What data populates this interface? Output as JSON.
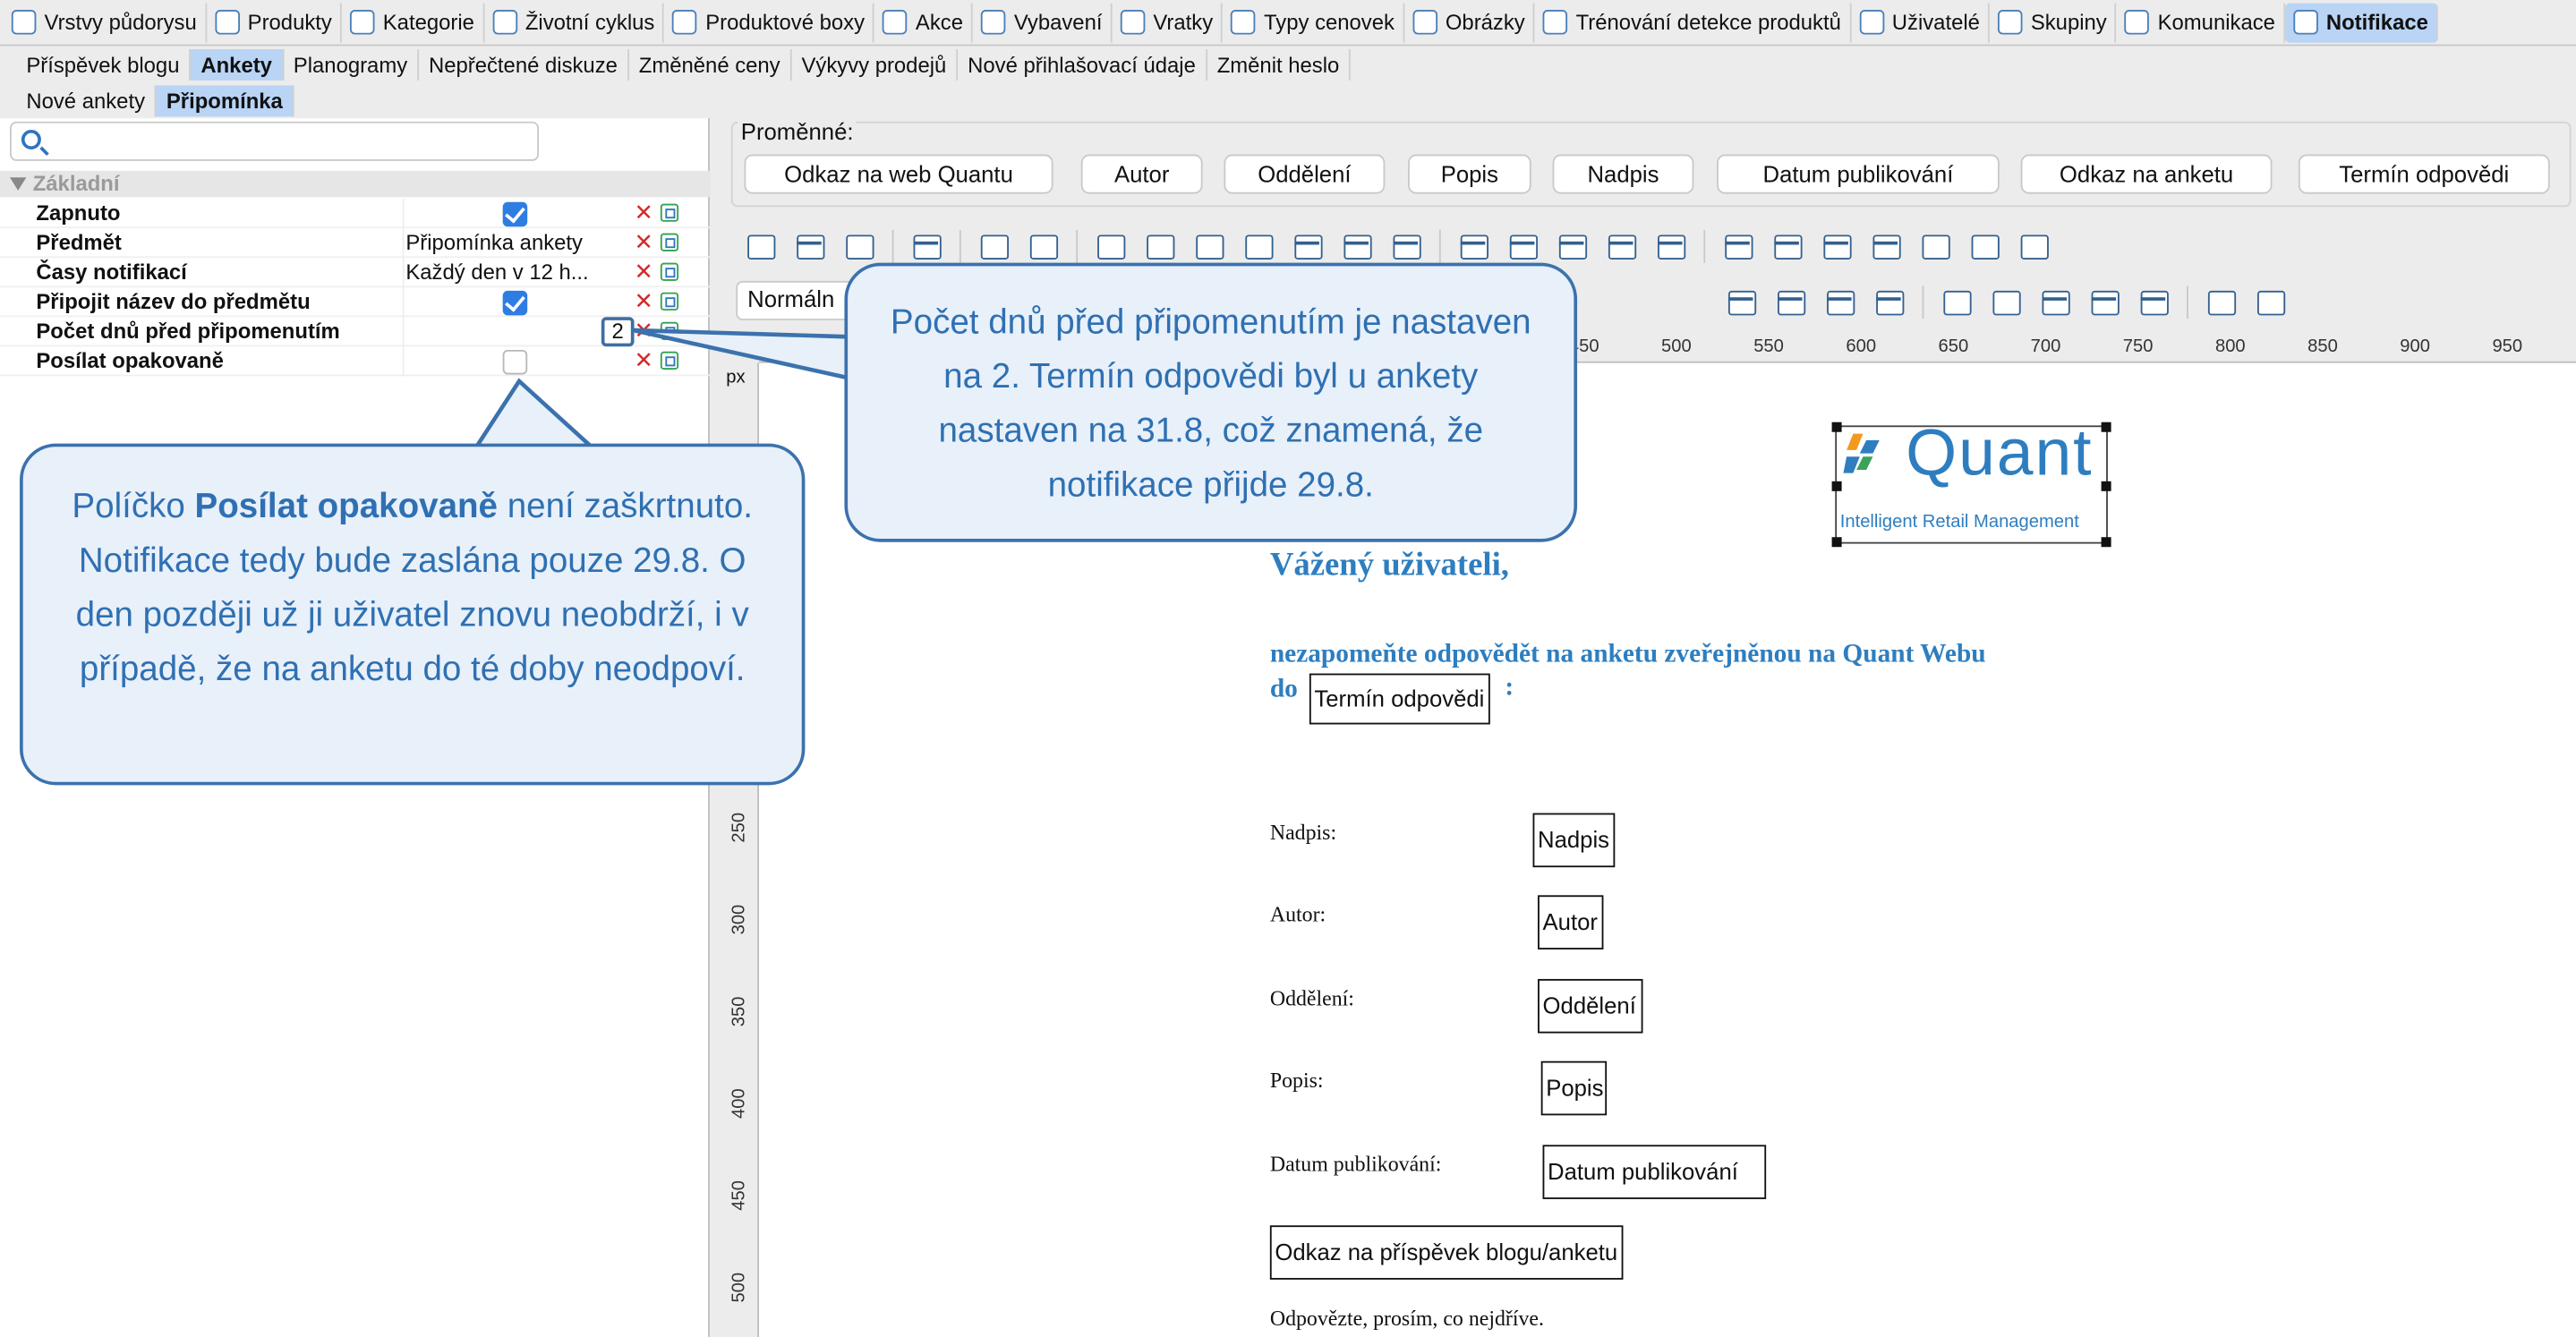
{
  "top_tabs": [
    {
      "label": "Vrstvy půdorysu",
      "icon": "floor-layers-icon"
    },
    {
      "label": "Produkty",
      "icon": "products-icon"
    },
    {
      "label": "Kategorie",
      "icon": "categories-icon"
    },
    {
      "label": "Životní cyklus",
      "icon": "lifecycle-icon"
    },
    {
      "label": "Produktové boxy",
      "icon": "product-boxes-icon"
    },
    {
      "label": "Akce",
      "icon": "promotions-icon"
    },
    {
      "label": "Vybavení",
      "icon": "equipment-icon"
    },
    {
      "label": "Vratky",
      "icon": "returns-icon"
    },
    {
      "label": "Typy cenovek",
      "icon": "price-tag-icon"
    },
    {
      "label": "Obrázky",
      "icon": "images-icon"
    },
    {
      "label": "Trénování detekce produktů",
      "icon": "training-icon"
    },
    {
      "label": "Uživatelé",
      "icon": "users-icon"
    },
    {
      "label": "Skupiny",
      "icon": "groups-icon"
    },
    {
      "label": "Komunikace",
      "icon": "mail-icon"
    },
    {
      "label": "Notifikace",
      "icon": "notification-icon"
    }
  ],
  "sub_tabs": [
    "Příspěvek blogu",
    "Ankety",
    "Planogramy",
    "Nepřečtené diskuze",
    "Změněné ceny",
    "Výkyvy prodejů",
    "Nové přihlašovací údaje",
    "Změnit heslo"
  ],
  "sub_tabs2": [
    "Nové ankety",
    "Připomínka"
  ],
  "group": "Základní",
  "props": [
    {
      "name": "Zapnuto",
      "value": "",
      "checked": true
    },
    {
      "name": "Předmět",
      "value": "Připomínka ankety"
    },
    {
      "name": "Časy notifikací",
      "value": "Každý den v 12 h..."
    },
    {
      "name": "Připojit název do předmětu",
      "value": "",
      "checked": true
    },
    {
      "name": "Počet dnů před připomenutím",
      "value": "2"
    },
    {
      "name": "Posílat opakovaně",
      "value": "",
      "checked": false
    }
  ],
  "variables_label": "Proměnné:",
  "variables": [
    "Odkaz na web Quantu",
    "Autor",
    "Oddělení",
    "Popis",
    "Nadpis",
    "Datum publikování",
    "Odkaz na anketu",
    "Termín odpovědi"
  ],
  "style_select": "Normáln",
  "ruler_ticks": [
    "450",
    "500",
    "550",
    "600",
    "650",
    "700",
    "750",
    "800",
    "850",
    "900",
    "950"
  ],
  "ruler_unit": "px",
  "vruler_ticks": [
    "250",
    "300",
    "350",
    "400",
    "450",
    "500"
  ],
  "logo": {
    "name": "Quant",
    "tagline": "Intelligent Retail Management"
  },
  "doc": {
    "greeting": "Vážený uživateli,",
    "line1": "nezapomeňte odpovědět na anketu zveřejněnou na Quant Webu",
    "line2": "do",
    "line2_end": ":",
    "deadline_field": "Termín odpovědi",
    "labels": [
      "Nadpis:",
      "Autor:",
      "Oddělení:",
      "Popis:",
      "Datum publikování:"
    ],
    "fields": [
      "Nadpis",
      "Autor",
      "Oddělení",
      "Popis",
      "Datum publikování"
    ],
    "link_field": "Odkaz na příspěvek blogu/anketu",
    "closing": "Odpovězte, prosím, co nejdříve."
  },
  "callout_right": "Počet dnů před připomenutím je nastaven na 2. Termín odpovědi byl u ankety nastaven na 31.8, což znamená, že notifikace přijde 29.8.",
  "callout_left": {
    "pre": "Políčko ",
    "bold": "Posílat opakovaně",
    "post": " není zaškrtnuto. Notifikace tedy bude zaslána pouze 29.8. O den později už ji uživatel znovu neobdrží, i v případě, že na anketu do té doby neodpoví."
  }
}
